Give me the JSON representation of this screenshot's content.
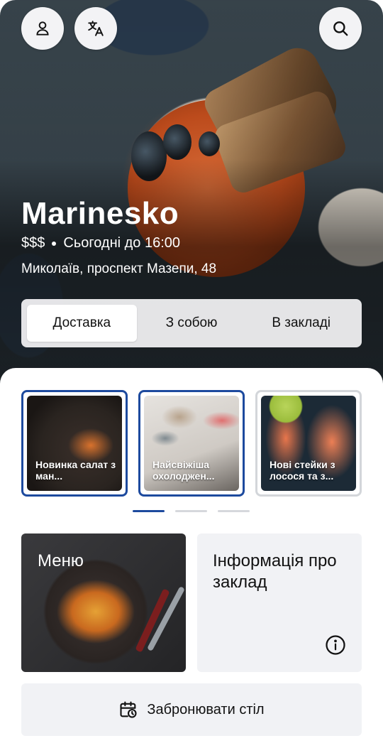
{
  "restaurant": {
    "name": "Marinesko",
    "price_level": "$$$",
    "hours": "Сьогодні до 16:00",
    "address": "Миколаїв, проспект Мазепи, 48"
  },
  "header": {
    "profile_icon": "user-icon",
    "translate_icon": "translate-icon",
    "search_icon": "search-icon"
  },
  "order_modes": [
    {
      "label": "Доставка",
      "active": true
    },
    {
      "label": "З собою",
      "active": false
    },
    {
      "label": "В закладі",
      "active": false
    }
  ],
  "stories": [
    {
      "text": "Новинка салат з ман...",
      "seen": false
    },
    {
      "text": "Найсвіжіша охолоджен...",
      "seen": false
    },
    {
      "text": "Нові стейки з лосося та з...",
      "seen": true
    }
  ],
  "pager": {
    "count": 3,
    "active_index": 0
  },
  "cards": {
    "menu_label": "Меню",
    "info_label": "Інформація про заклад"
  },
  "booking": {
    "label": "Забронювати стіл"
  },
  "colors": {
    "accent": "#1d4a9e",
    "card_bg": "#f1f2f5"
  }
}
